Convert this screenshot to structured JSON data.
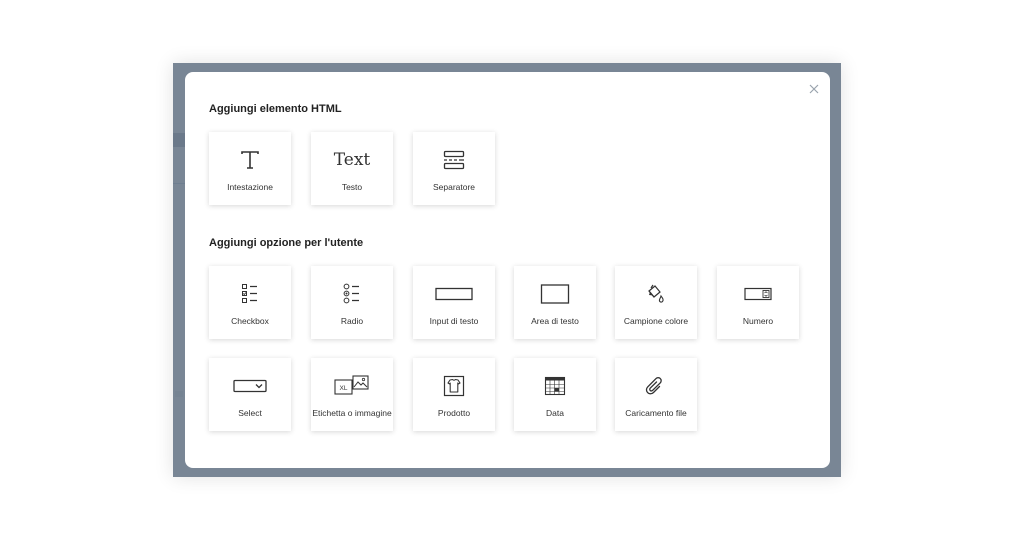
{
  "dialog": {
    "html_section_title": "Aggiungi elemento HTML",
    "html_items": [
      {
        "label": "Intestazione",
        "icon": "heading-icon"
      },
      {
        "label": "Testo",
        "icon": "text-icon",
        "icon_text": "Text"
      },
      {
        "label": "Separatore",
        "icon": "separator-icon"
      }
    ],
    "user_section_title": "Aggiungi opzione per l'utente",
    "user_items": [
      {
        "label": "Checkbox",
        "icon": "checkbox-icon"
      },
      {
        "label": "Radio",
        "icon": "radio-icon"
      },
      {
        "label": "Input di testo",
        "icon": "text-input-icon"
      },
      {
        "label": "Area di testo",
        "icon": "text-area-icon"
      },
      {
        "label": "Campione colore",
        "icon": "color-swatch-icon"
      },
      {
        "label": "Numero",
        "icon": "number-icon"
      },
      {
        "label": "Select",
        "icon": "select-icon"
      },
      {
        "label": "Etichetta o immagine",
        "icon": "label-image-icon",
        "icon_text": "XL"
      },
      {
        "label": "Prodotto",
        "icon": "product-icon"
      },
      {
        "label": "Data",
        "icon": "calendar-icon"
      },
      {
        "label": "Caricamento file",
        "icon": "paperclip-icon"
      }
    ],
    "close_icon": "close-icon"
  },
  "colors": {
    "overlay": "#707e8e",
    "dialog_bg": "#ffffff",
    "icon_stroke": "#333333"
  }
}
